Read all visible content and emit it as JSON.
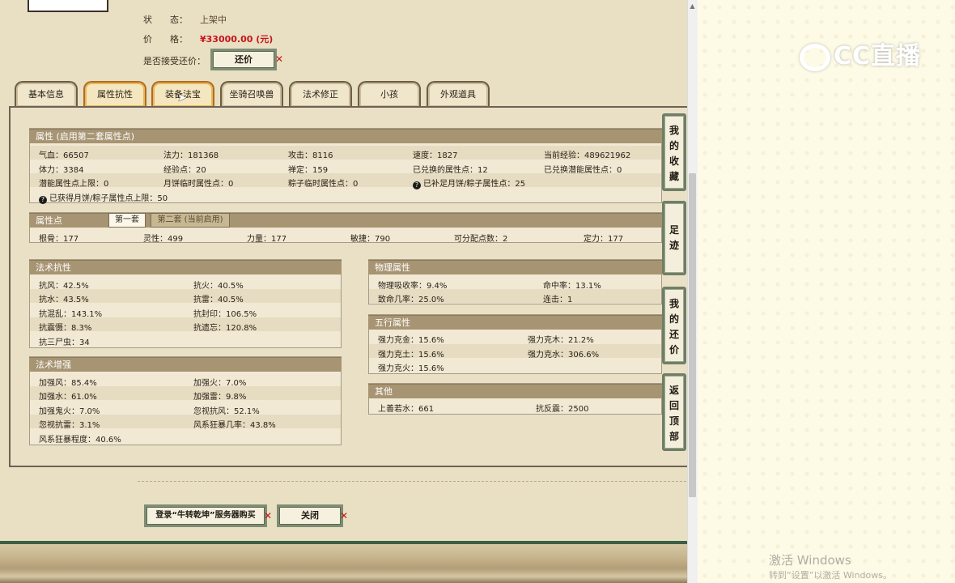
{
  "item": {
    "status_label": "状　　态：",
    "status_value": "上架中",
    "price_label": "价　　格：",
    "price_value": "¥33000.00 (元)",
    "bargain_label": "是否接受还价：",
    "bargain_button": "还价"
  },
  "tabs": [
    {
      "label": "基本信息"
    },
    {
      "label": "属性抗性"
    },
    {
      "label": "装备法宝"
    },
    {
      "label": "坐骑召唤兽"
    },
    {
      "label": "法术修正"
    },
    {
      "label": "小孩"
    },
    {
      "label": "外观道具"
    }
  ],
  "attributes": {
    "title": "属性 (启用第二套属性点)",
    "rows": [
      [
        "气血：66507",
        "法力：181368",
        "攻击：8116",
        "速度：1827",
        "当前经验：489621962"
      ],
      [
        "体力：3384",
        "经验点：20",
        "禅定：159",
        "已兑换的属性点：12",
        "已兑换潜能属性点：0"
      ],
      [
        "潜能属性点上限：0",
        "月饼临时属性点：0",
        "粽子临时属性点：0",
        "已补足月饼/粽子属性点：25",
        ""
      ]
    ],
    "note": "已获得月饼/粽子属性点上限：50"
  },
  "points": {
    "title": "属性点",
    "tab1": "第一套",
    "tab2": "第二套 (当前启用)",
    "values": [
      "根骨：177",
      "灵性：499",
      "力量：177",
      "敏捷：790",
      "可分配点数：2",
      "定力：177"
    ]
  },
  "resist": {
    "title": "法术抗性",
    "rows": [
      [
        "抗风：42.5%",
        "抗火：40.5%"
      ],
      [
        "抗水：43.5%",
        "抗雷：40.5%"
      ],
      [
        "抗混乱：143.1%",
        "抗封印：106.5%"
      ],
      [
        "抗震慑：8.3%",
        "抗遗忘：120.8%"
      ],
      [
        "抗三尸虫：34",
        ""
      ]
    ]
  },
  "enhance": {
    "title": "法术增强",
    "rows": [
      [
        "加强风：85.4%",
        "加强火：7.0%"
      ],
      [
        "加强水：61.0%",
        "加强雷：9.8%"
      ],
      [
        "加强鬼火：7.0%",
        "忽视抗风：52.1%"
      ],
      [
        "忽视抗雷：3.1%",
        "风系狂暴几率：43.8%"
      ],
      [
        "风系狂暴程度：40.6%",
        ""
      ]
    ]
  },
  "physical": {
    "title": "物理属性",
    "rows": [
      [
        "物理吸收率：9.4%",
        "命中率：13.1%"
      ],
      [
        "致命几率：25.0%",
        "连击：1"
      ]
    ]
  },
  "five": {
    "title": "五行属性",
    "rows": [
      [
        "强力克金：15.6%",
        "强力克木：21.2%"
      ],
      [
        "强力克土：15.6%",
        "强力克水：306.6%"
      ],
      [
        "强力克火：15.6%",
        ""
      ]
    ]
  },
  "other": {
    "title": "其他",
    "rows": [
      [
        "上善若水：661",
        "抗反震：2500"
      ]
    ]
  },
  "side": {
    "favorites": [
      "我",
      "的",
      "收",
      "藏"
    ],
    "footprints": [
      "足",
      "迹"
    ],
    "my_bargain": [
      "我",
      "的",
      "还",
      "价"
    ],
    "back_top": [
      "返",
      "回",
      "顶",
      "部"
    ]
  },
  "bottom": {
    "login_button": "登录“牛转乾坤”服务器购买",
    "close_button": "关闭"
  },
  "watermark": {
    "logo": "CC直播",
    "activate": "激活 Windows",
    "activate_sub": "转到“设置”以激活 Windows。"
  }
}
